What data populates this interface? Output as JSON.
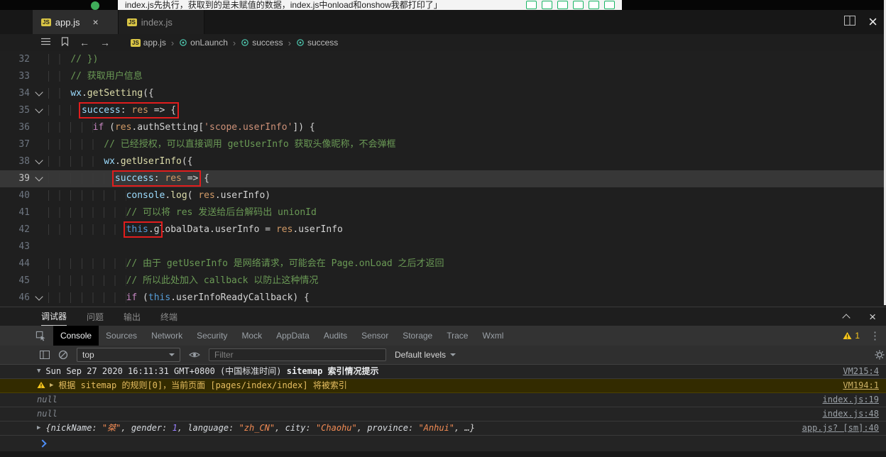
{
  "overlay": {
    "title": "index.js先执行，获取到的是未赋值的数据，index.js中onload和onshow我都打印了」",
    "icons": [
      "calendar-icon",
      "refresh-icon",
      "phone-icon",
      "doc-icon",
      "monitor-icon",
      "settings-icon"
    ]
  },
  "editor_tabs": [
    {
      "label": "app.js",
      "active": true,
      "close": "×"
    },
    {
      "label": "index.js",
      "active": false
    }
  ],
  "breadcrumb": [
    "app.js",
    "onLaunch",
    "success",
    "success"
  ],
  "editor": {
    "lines": [
      {
        "num": 32,
        "ind": "    ",
        "tokens": [
          {
            "t": "// })",
            "c": "com"
          }
        ]
      },
      {
        "num": 33,
        "ind": "    ",
        "tokens": [
          {
            "t": "// 获取用户信息",
            "c": "com"
          }
        ]
      },
      {
        "num": 34,
        "ind": "    ",
        "fold": true,
        "tokens": [
          {
            "t": "wx",
            "c": "var"
          },
          {
            "t": ".",
            "c": "fg"
          },
          {
            "t": "getSetting",
            "c": "fn"
          },
          {
            "t": "({",
            "c": "fg"
          }
        ]
      },
      {
        "num": 35,
        "ind": "      ",
        "fold": true,
        "tokens": [
          {
            "t": "success",
            "c": "prop",
            "b": true
          },
          {
            "t": ": ",
            "c": "fg",
            "b": true
          },
          {
            "t": "res",
            "c": "param",
            "b": true
          },
          {
            "t": " ",
            "c": "fg",
            "b": true
          },
          {
            "t": "=>",
            "c": "fg",
            "b": true
          },
          {
            "t": " {",
            "c": "fg",
            "b": true
          }
        ]
      },
      {
        "num": 36,
        "ind": "        ",
        "tokens": [
          {
            "t": "if",
            "c": "kw"
          },
          {
            "t": " (",
            "c": "fg"
          },
          {
            "t": "res",
            "c": "param"
          },
          {
            "t": ".",
            "c": "fg"
          },
          {
            "t": "authSetting",
            "c": "fg"
          },
          {
            "t": "[",
            "c": "fg"
          },
          {
            "t": "'scope.userInfo'",
            "c": "str"
          },
          {
            "t": "]",
            "c": "fg"
          },
          {
            "t": ") {",
            "c": "fg"
          }
        ]
      },
      {
        "num": 37,
        "ind": "          ",
        "tokens": [
          {
            "t": "// 已经授权，可以直接调用 getUserInfo 获取头像昵称，不会弹框",
            "c": "com"
          }
        ]
      },
      {
        "num": 38,
        "ind": "          ",
        "fold": true,
        "tokens": [
          {
            "t": "wx",
            "c": "var"
          },
          {
            "t": ".",
            "c": "fg"
          },
          {
            "t": "getUserInfo",
            "c": "fn"
          },
          {
            "t": "({",
            "c": "fg"
          }
        ]
      },
      {
        "num": 39,
        "ind": "            ",
        "fold": true,
        "hl": true,
        "tokens": [
          {
            "t": "success",
            "c": "prop",
            "b": true
          },
          {
            "t": ": ",
            "c": "fg",
            "b": true
          },
          {
            "t": "res",
            "c": "param",
            "b": true
          },
          {
            "t": " ",
            "c": "fg",
            "b": true
          },
          {
            "t": "=>",
            "c": "fg",
            "b": true
          },
          {
            "t": " {",
            "c": "fg"
          }
        ]
      },
      {
        "num": 40,
        "ind": "              ",
        "tokens": [
          {
            "t": "console",
            "c": "var"
          },
          {
            "t": ".",
            "c": "fg"
          },
          {
            "t": "log",
            "c": "fn"
          },
          {
            "t": "( ",
            "c": "fg"
          },
          {
            "t": "res",
            "c": "param"
          },
          {
            "t": ".",
            "c": "fg"
          },
          {
            "t": "userInfo",
            "c": "fg"
          },
          {
            "t": ")",
            "c": "fg"
          }
        ]
      },
      {
        "num": 41,
        "ind": "              ",
        "tokens": [
          {
            "t": "// 可以将 res 发送给后台解码出 unionId",
            "c": "com"
          }
        ]
      },
      {
        "num": 42,
        "ind": "              ",
        "tokens": [
          {
            "t": "this",
            "c": "this",
            "b": true
          },
          {
            "t": ".g",
            "c": "fg",
            "b": true
          },
          {
            "t": "lobalData",
            "c": "fg"
          },
          {
            "t": ".",
            "c": "fg"
          },
          {
            "t": "userInfo",
            "c": "fg"
          },
          {
            "t": " = ",
            "c": "fg"
          },
          {
            "t": "res",
            "c": "param"
          },
          {
            "t": ".",
            "c": "fg"
          },
          {
            "t": "userInfo",
            "c": "fg"
          }
        ]
      },
      {
        "num": 43,
        "ind": "",
        "tokens": []
      },
      {
        "num": 44,
        "ind": "              ",
        "tokens": [
          {
            "t": "// 由于 getUserInfo 是网络请求，可能会在 Page.onLoad 之后才返回",
            "c": "com"
          }
        ]
      },
      {
        "num": 45,
        "ind": "              ",
        "tokens": [
          {
            "t": "// 所以此处加入 callback 以防止这种情况",
            "c": "com"
          }
        ]
      },
      {
        "num": 46,
        "ind": "              ",
        "fold": true,
        "tokens": [
          {
            "t": "if",
            "c": "kw"
          },
          {
            "t": " (",
            "c": "fg"
          },
          {
            "t": "this",
            "c": "this"
          },
          {
            "t": ".",
            "c": "fg"
          },
          {
            "t": "userInfoReadyCallback",
            "c": "fg"
          },
          {
            "t": ") {",
            "c": "fg"
          }
        ]
      }
    ]
  },
  "panel": {
    "tabs": [
      {
        "label": "调试器",
        "active": true
      },
      {
        "label": "问题",
        "active": false
      },
      {
        "label": "输出",
        "active": false
      },
      {
        "label": "终端",
        "active": false
      }
    ]
  },
  "devtools": {
    "tabs": [
      {
        "label": "Console",
        "active": true
      },
      {
        "label": "Sources",
        "active": false
      },
      {
        "label": "Network",
        "active": false
      },
      {
        "label": "Security",
        "active": false
      },
      {
        "label": "Mock",
        "active": false
      },
      {
        "label": "AppData",
        "active": false
      },
      {
        "label": "Audits",
        "active": false
      },
      {
        "label": "Sensor",
        "active": false
      },
      {
        "label": "Storage",
        "active": false
      },
      {
        "label": "Trace",
        "active": false
      },
      {
        "label": "Wxml",
        "active": false
      }
    ],
    "warning_count": "1"
  },
  "toolbar": {
    "context": "top",
    "filter_placeholder": "Filter",
    "levels": "Default levels"
  },
  "console_rows": [
    {
      "type": "group",
      "prefix": "Sun Sep 27 2020 16:11:31 GMT+0800 (中国标准时间)",
      "text": "sitemap 索引情况提示",
      "link": "VM215:4"
    },
    {
      "type": "warning",
      "text": "根据 sitemap 的规则[0]，当前页面 [pages/index/index] 将被索引",
      "link": "VM194:1"
    },
    {
      "type": "log",
      "text": "null",
      "link": "index.js:19"
    },
    {
      "type": "log",
      "text": "null",
      "link": "index.js:48"
    },
    {
      "type": "object",
      "link": "app.js? [sm]:40",
      "parts": [
        {
          "t": "{",
          "c": "b"
        },
        {
          "t": "nickName",
          "c": "k"
        },
        {
          "t": ": ",
          "c": "b"
        },
        {
          "t": "\"桀\"",
          "c": "s"
        },
        {
          "t": ", ",
          "c": "b"
        },
        {
          "t": "gender",
          "c": "k"
        },
        {
          "t": ": ",
          "c": "b"
        },
        {
          "t": "1",
          "c": "n"
        },
        {
          "t": ", ",
          "c": "b"
        },
        {
          "t": "language",
          "c": "k"
        },
        {
          "t": ": ",
          "c": "b"
        },
        {
          "t": "\"zh_CN\"",
          "c": "s"
        },
        {
          "t": ", ",
          "c": "b"
        },
        {
          "t": "city",
          "c": "k"
        },
        {
          "t": ": ",
          "c": "b"
        },
        {
          "t": "\"Chaohu\"",
          "c": "s"
        },
        {
          "t": ", ",
          "c": "b"
        },
        {
          "t": "province",
          "c": "k"
        },
        {
          "t": ": ",
          "c": "b"
        },
        {
          "t": "\"Anhui\"",
          "c": "s"
        },
        {
          "t": ", ",
          "c": "b"
        },
        {
          "t": "…",
          "c": "b"
        },
        {
          "t": "}",
          "c": "b"
        }
      ]
    }
  ],
  "colors": {
    "red_box": "#e11d1d",
    "wechat_green": "#1aad19",
    "warning_yellow": "#f5c51d",
    "prompt_blue": "#4e8ef7",
    "comment_green": "#6a9955",
    "string_orange": "#ce9178"
  }
}
